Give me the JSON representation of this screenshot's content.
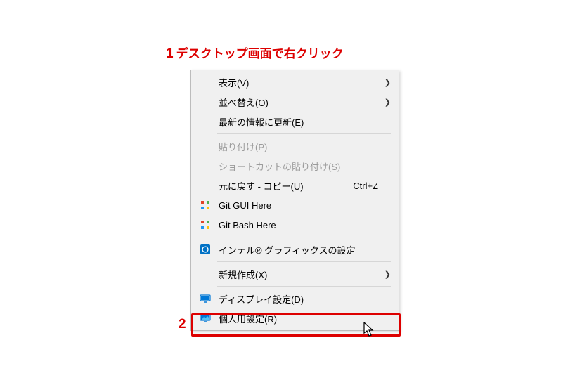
{
  "annotation1": {
    "num": "1",
    "text": "デスクトップ画面で右クリック"
  },
  "annotation2": {
    "num": "2"
  },
  "menu": {
    "view": {
      "label": "表示(V)",
      "submenu": true
    },
    "sort": {
      "label": "並べ替え(O)",
      "submenu": true
    },
    "refresh": {
      "label": "最新の情報に更新(E)"
    },
    "paste": {
      "label": "貼り付け(P)",
      "disabled": true
    },
    "pasteShortcut": {
      "label": "ショートカットの貼り付け(S)",
      "disabled": true
    },
    "undo": {
      "label": "元に戻す - コピー(U)",
      "shortcut": "Ctrl+Z"
    },
    "gitGui": {
      "label": "Git GUI Here"
    },
    "gitBash": {
      "label": "Git Bash Here"
    },
    "intel": {
      "label": "インテル® グラフィックスの設定"
    },
    "new": {
      "label": "新規作成(X)",
      "submenu": true
    },
    "display": {
      "label": "ディスプレイ設定(D)"
    },
    "personalize": {
      "label": "個人用設定(R)"
    }
  }
}
